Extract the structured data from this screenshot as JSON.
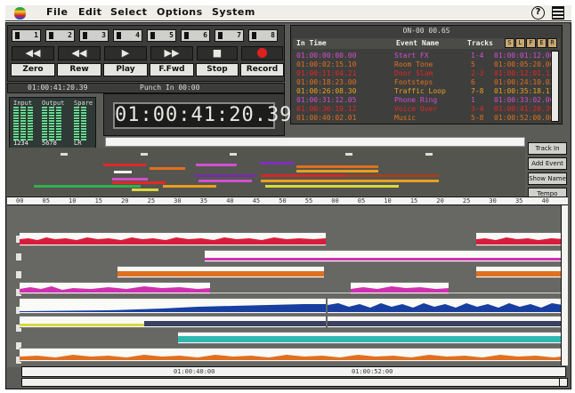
{
  "menubar": {
    "items": [
      "File",
      "Edit",
      "Select",
      "Options",
      "System"
    ],
    "help_label": "?"
  },
  "transport": {
    "tracks": [
      {
        "label": "1"
      },
      {
        "label": "2"
      },
      {
        "label": "3"
      },
      {
        "label": "4"
      },
      {
        "label": "5"
      },
      {
        "label": "6"
      },
      {
        "label": "7"
      },
      {
        "label": "8"
      }
    ],
    "buttons": [
      {
        "symbol": "◀◀",
        "label": "Zero"
      },
      {
        "symbol": "◀◀",
        "label": "Rew"
      },
      {
        "symbol": "▶",
        "label": "Play"
      },
      {
        "symbol": "▶▶",
        "label": "F.Fwd"
      },
      {
        "symbol": "■",
        "label": "Stop"
      },
      {
        "symbol": "",
        "label": "Record"
      }
    ],
    "timecode": "01:00:41:20.39",
    "strip_right": "Punch In 00:00"
  },
  "meters": {
    "top_labels": [
      "Input",
      "Output",
      "Spare"
    ],
    "bottom_labels": [
      "1234",
      "5678",
      "LR"
    ]
  },
  "counter": {
    "value": "01:00:41:20.39"
  },
  "events": {
    "title": "ON-00 00.6S",
    "columns": [
      "In Time",
      "Event Name",
      "Tracks"
    ],
    "header_buttons": [
      "S",
      "L",
      "F",
      "E",
      "R"
    ],
    "rows": [
      {
        "time": "01:00:00:00.00",
        "name": "Start FX",
        "tracks": "1-4",
        "end": "01:00:01:12.00",
        "color": "#d050d0"
      },
      {
        "time": "01:00:02:15.10",
        "name": "Room Tone",
        "tracks": "5",
        "end": "01:00:05:20.00",
        "color": "#e07020"
      },
      {
        "time": "01:00:11:04.21",
        "name": "Door Slam",
        "tracks": "2-3",
        "end": "01:00:12:01.13",
        "color": "#e02828"
      },
      {
        "time": "01:00:18:23.00",
        "name": "Footsteps",
        "tracks": "6",
        "end": "01:00:24:10.02",
        "color": "#e07020"
      },
      {
        "time": "01:00:26:08.30",
        "name": "Traffic Loop",
        "tracks": "7-8",
        "end": "01:00:35:18.11",
        "color": "#e8a020"
      },
      {
        "time": "01:00:31:12.05",
        "name": "Phone Ring",
        "tracks": "1",
        "end": "01:00:33:02.00",
        "color": "#d050d0"
      },
      {
        "time": "01:00:36:19.12",
        "name": "Voice Over",
        "tracks": "3-4",
        "end": "01:00:41:20.39",
        "color": "#e02828"
      },
      {
        "time": "01:00:40:02.01",
        "name": "Music",
        "tracks": "5-8",
        "end": "01:00:52:00.00",
        "color": "#e07020"
      }
    ]
  },
  "side_buttons": [
    "Track In",
    "Add Event",
    "Show Name",
    "Tempo"
  ],
  "ruler": {
    "ticks": [
      "00",
      "05",
      "10",
      "15",
      "20",
      "25",
      "30",
      "35",
      "40",
      "45",
      "50",
      "55",
      "00",
      "05",
      "10",
      "15",
      "20",
      "25",
      "30",
      "35",
      "40"
    ]
  },
  "bottom_ruler": {
    "left": "01:00:40:00",
    "right": "01:00:52:00"
  },
  "colors": {
    "magenta": "#d030b0",
    "red": "#d81c3c",
    "orange": "#e07020",
    "blue": "#183fa0",
    "teal": "#30b8b0",
    "yellow": "#d8d840"
  }
}
